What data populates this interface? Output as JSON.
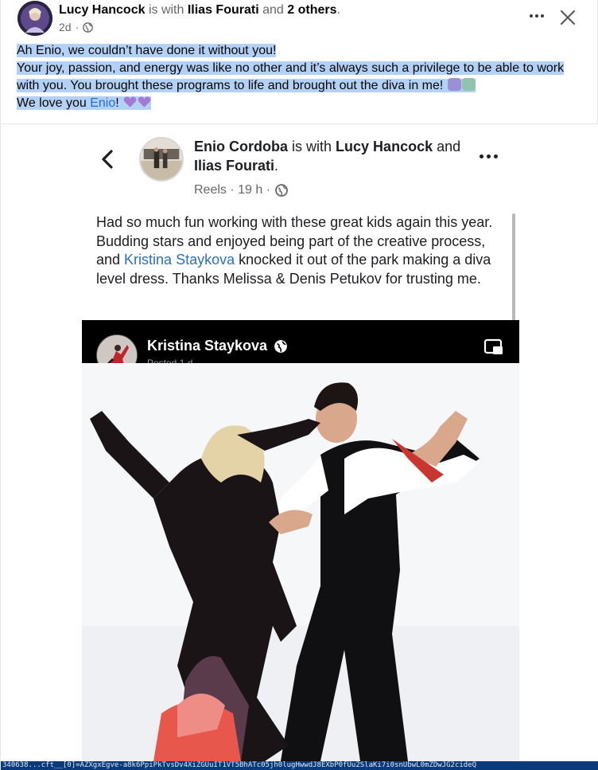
{
  "post": {
    "author": "Lucy Hancock",
    "with_word": "is with",
    "tagged": "Ilias Fourati",
    "and_word": "and",
    "others": "2 others",
    "period": ".",
    "time": "2d",
    "text": {
      "line1": "Ah Enio, we couldn’t have done it without you!",
      "line2": "Your joy, passion, and energy was like no other and it’s always such a privilege to be able to work with you. You brought these programs to life and brought out the diva in me!",
      "line3_prefix": "We love you ",
      "line3_link": "Enio",
      "line3_suffix": "!"
    },
    "icons": {
      "more": "more-horizontal-icon",
      "close": "close-icon",
      "audience": "globe-icon"
    }
  },
  "embed": {
    "author": "Enio Cordoba",
    "with_word": "is with",
    "tagged1": "Lucy Hancock",
    "and_word": "and",
    "tagged2": "Ilias Fourati",
    "period": ".",
    "meta": "Reels · 19 h ·",
    "text_part1": "Had so much fun working with these great kids again this year. Budding stars and enjoyed being part of the creative process, and ",
    "text_link": "Kristina Staykova",
    "text_part2": " knocked it out of the park making a diva level dress. Thanks Melissa & Denis Petukov for trusting me.",
    "video": {
      "author": "Kristina Staykova",
      "sub": "Posted 1 d"
    }
  },
  "url_strip": "340638...cft__[0]=AZXgxEgve-a8k6PpiPkTvsDv4XiZGUuIT1VT5BhATc05jh0lugHwwdJ8EXbP0fUu2SlaKi7i0snUbwL0mZDwJG2cideQ",
  "colors": {
    "highlight": "#b3d1f5",
    "link": "#216fdb",
    "muted": "#65676b"
  }
}
